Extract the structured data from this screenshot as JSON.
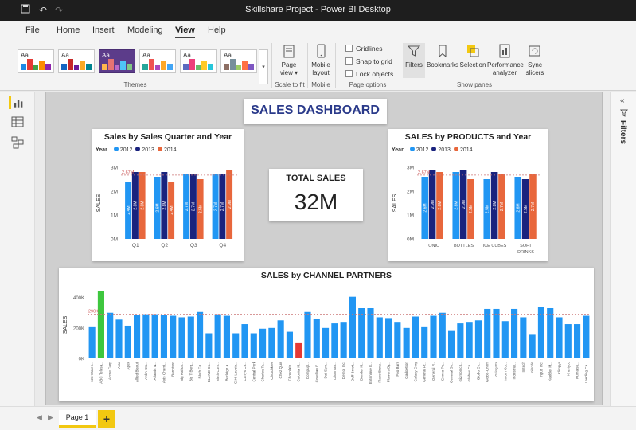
{
  "window": {
    "title": "Skillshare Project - Power BI Desktop"
  },
  "menu": [
    "File",
    "Home",
    "Insert",
    "Modeling",
    "View",
    "Help"
  ],
  "menu_active": "View",
  "ribbon": {
    "themes_label": "Themes",
    "page_view": "Page view",
    "scale_to_fit": "Scale to fit",
    "mobile_layout": "Mobile layout",
    "mobile": "Mobile",
    "gridlines": "Gridlines",
    "snap_to_grid": "Snap to grid",
    "lock_objects": "Lock objects",
    "page_options": "Page options",
    "filters": "Filters",
    "bookmarks": "Bookmarks",
    "selection": "Selection",
    "performance_analyzer": "Performance analyzer",
    "sync_slicers": "Sync slicers",
    "show_panes": "Show panes"
  },
  "right_pane": {
    "filters_label": "Filters"
  },
  "pages": {
    "tab": "Page 1",
    "add": "+"
  },
  "dashboard": {
    "title": "SALES DASHBOARD",
    "total_sales_label": "TOTAL SALES",
    "total_sales_value": "32M"
  },
  "colors": {
    "s2012": "#2196f3",
    "s2013": "#1a237e",
    "s2014": "#e8673c",
    "green": "#3ec73e",
    "red": "#e53935",
    "accent": "#f2c811"
  },
  "chart_data": [
    {
      "type": "bar",
      "title": "Sales by Sales Quarter and Year",
      "legend_title": "Year",
      "categories": [
        "Q1",
        "Q2",
        "Q3",
        "Q4"
      ],
      "series": [
        {
          "name": "2012",
          "values": [
            2.4,
            2.6,
            2.7,
            2.7
          ],
          "labels": [
            "2.4M",
            "2.6M",
            "2.7M",
            "2.7M"
          ]
        },
        {
          "name": "2013",
          "values": [
            2.8,
            2.8,
            2.7,
            2.7
          ],
          "labels": [
            "2.8M",
            "2.8M",
            "2.7M",
            "2.7M"
          ]
        },
        {
          "name": "2014",
          "values": [
            2.8,
            2.4,
            2.5,
            2.9
          ],
          "labels": [
            "2.8M",
            "2.4M",
            "2.5M",
            "2.9M"
          ]
        }
      ],
      "ylabel": "SALES",
      "yticks": [
        "0M",
        "1M",
        "2M",
        "3M"
      ],
      "ylim": [
        0,
        3
      ],
      "reference_line": {
        "value": 2.67,
        "label": "2.67M"
      },
      "legend_position": "top-left"
    },
    {
      "type": "bar",
      "title": "SALES by PRODUCTS and Year",
      "legend_title": "Year",
      "categories": [
        "TONIC",
        "BOTTLES",
        "ICE CUBES",
        "SOFT DRINKS"
      ],
      "series": [
        {
          "name": "2012",
          "values": [
            2.6,
            2.8,
            2.5,
            2.6
          ],
          "labels": [
            "2.6M",
            "2.8M",
            "2.5M",
            "2.6M"
          ]
        },
        {
          "name": "2013",
          "values": [
            2.9,
            2.9,
            2.8,
            2.5
          ],
          "labels": [
            "2.9M",
            "2.9M",
            "2.8M",
            "2.5M"
          ]
        },
        {
          "name": "2014",
          "values": [
            2.8,
            2.5,
            2.7,
            2.7
          ],
          "labels": [
            "2.8M",
            "2.5M",
            "2.7M",
            "2.7M"
          ]
        }
      ],
      "ylabel": "SALES",
      "yticks": [
        "0M",
        "1M",
        "2M",
        "3M"
      ],
      "ylim": [
        0,
        3
      ],
      "reference_line": {
        "value": 2.67,
        "label": "2.67M"
      },
      "legend_position": "top-left"
    },
    {
      "type": "bar",
      "title": "SALES by CHANNEL PARTNERS",
      "ylabel": "SALES",
      "yticks": [
        "0K",
        "200K",
        "400K"
      ],
      "ylim": [
        0,
        440
      ],
      "reference_line": {
        "value": 290,
        "label": "290K"
      },
      "categories": [
        "123 Wareh...",
        "ABC Telesa...",
        "Acme Corp",
        "Ajax",
        "Apex",
        "Allied Biscuit",
        "Ankh-Sto...",
        "Atlantic N...",
        "Axis Chemi...",
        "Barrytron",
        "Big Kahun...",
        "Big T Burg...",
        "Bluth Co...",
        "BLAND Co...",
        "Bluth Com...",
        "Burleigh a...",
        "C.H. Lavato...",
        "Carrys Co...",
        "Central Perk",
        "Charles Tc...",
        "Chotchkies",
        "Chez Quis",
        "Chocolate...",
        "Colonial M...",
        "Compugl...",
        "Corellian E...",
        "Dai-Sym...",
        "Dharma I...",
        "Demo, Inc.",
        "Duff Brewi...",
        "Dunder M...",
        "Extensive E...",
        "Flake Brew...",
        "Flowers By...",
        "Foo Bars",
        "Gadgetron",
        "Galaxy Corp",
        "General Pr...",
        "General P...",
        "Genco Pu...",
        "General Se...",
        "Gizmonic I...",
        "Globex Co...",
        "Globo Ch...",
        "Globo-Chem",
        "Gringotts",
        "Incom Cor...",
        "Industrial...",
        "Initech",
        "Initrode",
        "Input, Inc.",
        "Keebler M...",
        "Klimpys",
        "Krustyco",
        "Kumatsu...",
        "Leeding Ca..."
      ],
      "values": [
        205,
        440,
        300,
        255,
        215,
        285,
        290,
        290,
        285,
        280,
        270,
        275,
        305,
        165,
        290,
        280,
        165,
        225,
        165,
        195,
        200,
        250,
        175,
        100,
        305,
        260,
        200,
        230,
        240,
        405,
        330,
        330,
        270,
        265,
        240,
        200,
        275,
        205,
        280,
        300,
        180,
        230,
        240,
        250,
        325,
        325,
        245,
        325,
        270,
        155,
        340,
        330,
        270,
        225,
        225,
        280
      ],
      "highlight": {
        "max_index": 1,
        "min_index": 23
      },
      "legend_position": "none"
    }
  ]
}
